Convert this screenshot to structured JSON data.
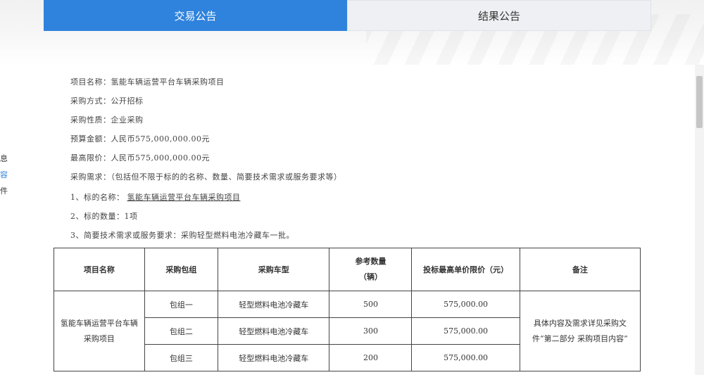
{
  "tabs": [
    {
      "label": "交易公告",
      "active": true
    },
    {
      "label": "结果公告",
      "active": false
    }
  ],
  "side_nav": [
    {
      "label": "息",
      "active": false
    },
    {
      "label": "容",
      "active": true
    },
    {
      "label": "件",
      "active": false
    }
  ],
  "info": {
    "project_name": "项目名称：氢能车辆运营平台车辆采购项目",
    "procurement_method": "采购方式：公开招标",
    "procurement_nature": "采购性质：企业采购",
    "budget": "预算金额：人民币575,000,000.00元",
    "max_price": "最高限价：人民币575,000,000.00元",
    "requirements": "采购需求：（包括但不限于标的的名称、数量、简要技术需求或服务要求等）",
    "item1_prefix": "1、标的名称：",
    "item1_value": "氢能车辆运营平台车辆采购项目",
    "item2": "2、标的数量：1项",
    "item3": "3、简要技术需求或服务要求：采购轻型燃料电池冷藏车一批。"
  },
  "table": {
    "headers": {
      "project": "项目名称",
      "package": "采购包组",
      "vehicle": "采购车型",
      "qty_line1": "参考数量",
      "qty_line2": "（辆）",
      "price": "投标最高单价限价（元）",
      "remark": "备注"
    },
    "project_name": "氢能车辆运营平台车辆采购项目",
    "remark": "具体内容及需求详见采购文件“第二部分 采购项目内容”",
    "rows": [
      {
        "package": "包组一",
        "vehicle": "轻型燃料电池冷藏车",
        "qty": "500",
        "price": "575,000.00"
      },
      {
        "package": "包组二",
        "vehicle": "轻型燃料电池冷藏车",
        "qty": "300",
        "price": "575,000.00"
      },
      {
        "package": "包组三",
        "vehicle": "轻型燃料电池冷藏车",
        "qty": "200",
        "price": "575,000.00"
      }
    ]
  },
  "colors": {
    "accent": "#2f83dd",
    "tab_inactive_bg": "#eef0f3"
  }
}
